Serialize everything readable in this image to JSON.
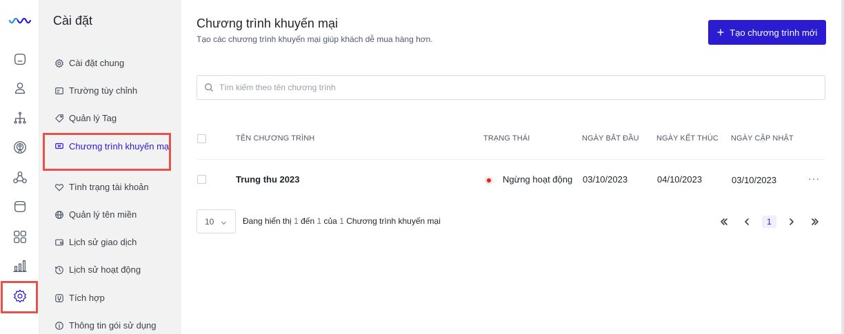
{
  "rail": {
    "items": [
      {
        "name": "home-icon"
      },
      {
        "name": "user-icon"
      },
      {
        "name": "org-tree-icon"
      },
      {
        "name": "broadcast-icon"
      },
      {
        "name": "network-icon"
      },
      {
        "name": "storage-icon"
      },
      {
        "name": "apps-grid-icon"
      },
      {
        "name": "bar-chart-icon"
      },
      {
        "name": "gear-icon",
        "active": true
      }
    ]
  },
  "settings": {
    "title": "Cài đặt",
    "items": [
      {
        "label": "Cài đặt chung",
        "icon": "gear-icon"
      },
      {
        "label": "Trường tùy chỉnh",
        "icon": "custom-field-icon"
      },
      {
        "label": "Quản lý Tag",
        "icon": "tag-icon"
      },
      {
        "label": "Chương trình khuyến mại",
        "icon": "ticket-icon",
        "active": true
      },
      {
        "label": "Tình trạng tài khoản",
        "icon": "heart-icon"
      },
      {
        "label": "Quản lý tên miền",
        "icon": "globe-icon"
      },
      {
        "label": "Lịch sử giao dịch",
        "icon": "wallet-icon"
      },
      {
        "label": "Lịch sử hoạt động",
        "icon": "history-icon"
      },
      {
        "label": "Tích hợp",
        "icon": "integration-icon"
      },
      {
        "label": "Thông tin gói sử dụng",
        "icon": "info-icon"
      }
    ]
  },
  "main": {
    "title": "Chương trình khuyến mại",
    "subtitle": "Tạo các chương trình khuyến mại giúp khách dễ mua hàng hơn.",
    "create_label": "Tạo chương trình mới",
    "search_placeholder": "Tìm kiếm theo tên chương trình",
    "columns": [
      "TÊN CHƯƠNG TRÌNH",
      "TRẠNG THÁI",
      "NGÀY BẮT ĐẦU",
      "NGÀY KẾT THÚC",
      "NGÀY CẬP NHẬT"
    ],
    "rows": [
      {
        "name": "Trung thu 2023",
        "status": "Ngừng hoạt động",
        "start": "03/10/2023",
        "end": "04/10/2023",
        "updated": "03/10/2023",
        "more": "···"
      }
    ],
    "pagination": {
      "page_size": "10",
      "summary_prefix": "Đang hiển thị",
      "from": "1",
      "to_word": "đến",
      "to": "1",
      "of_word": "của",
      "total": "1",
      "summary_suffix": "Chương trình khuyến mại",
      "current_page": "1"
    }
  },
  "colors": {
    "accent": "#2b1bd1",
    "highlight": "#e8514a",
    "status_inactive": "#e0221c"
  }
}
